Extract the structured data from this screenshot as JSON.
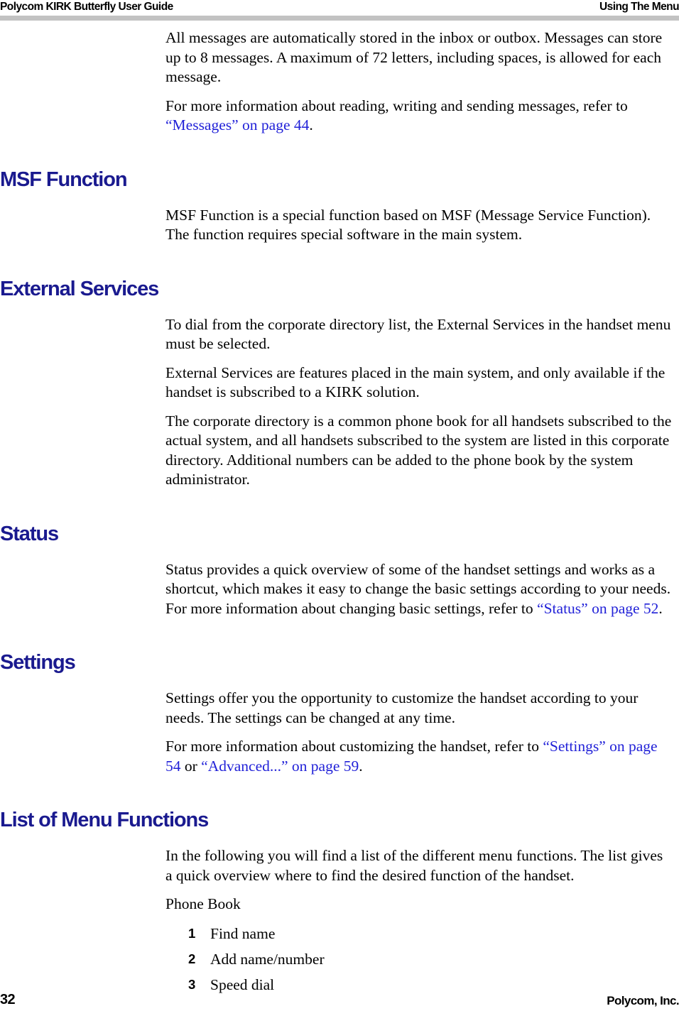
{
  "header": {
    "left": "Polycom KIRK Butterfly User Guide",
    "right": "Using The Menu"
  },
  "footer": {
    "page_number": "32",
    "company": "Polycom, Inc."
  },
  "colors": {
    "heading": "#1a1a8f",
    "link": "#2222d8",
    "rule": "#c2c2c2",
    "body": "#000000"
  },
  "intro": {
    "paragraph_1": "All messages are automatically stored in the inbox or outbox. Messages can store up to 8 messages. A maximum of 72 letters, including spaces, is allowed for each message.",
    "paragraph_2_prefix": "For more information about reading, writing and sending messages, refer to ",
    "paragraph_2_link": "“Messages” on page 44",
    "paragraph_2_suffix": "."
  },
  "sections": [
    {
      "heading": "MSF Function",
      "paragraph_1": "MSF Function is a special function based on MSF (Message Service Function). The function requires special software in the main system."
    },
    {
      "heading": "External Services",
      "paragraph_1": "To dial from the corporate directory list, the External Services in the handset menu must be selected.",
      "paragraph_2": "External Services are features placed in the main system, and only available if the handset is subscribed to a KIRK solution.",
      "paragraph_3": "The corporate directory is a common phone book for all handsets subscribed to the actual system, and all handsets subscribed to the system are listed in this corporate directory. Additional numbers can be added to the phone book by the system administrator."
    },
    {
      "heading": "Status",
      "paragraph_1_prefix": "Status provides a quick overview of some of the handset settings and works as a shortcut, which makes it easy to change the basic settings according to your needs. For more information about changing basic settings, refer to ",
      "paragraph_1_link": "“Status” on page 52",
      "paragraph_1_suffix": "."
    },
    {
      "heading": "Settings",
      "paragraph_1": "Settings offer you the opportunity to customize the handset according to your needs. The settings can be changed at any time.",
      "paragraph_2_prefix": "For more information about customizing the handset, refer to ",
      "paragraph_2_link_1": "“Settings” on page 54",
      "paragraph_2_mid": " or ",
      "paragraph_2_link_2": "“Advanced...” on page 59",
      "paragraph_2_suffix": "."
    },
    {
      "heading": "List of Menu Functions",
      "paragraph_1": "In the following you will find a list of the different menu functions. The list gives a quick overview where to find the desired function of the handset.",
      "paragraph_2": "Phone Book",
      "list": [
        {
          "num": "1",
          "label": "Find name"
        },
        {
          "num": "2",
          "label": "Add name/number"
        },
        {
          "num": "3",
          "label": "Speed dial"
        }
      ]
    }
  ]
}
